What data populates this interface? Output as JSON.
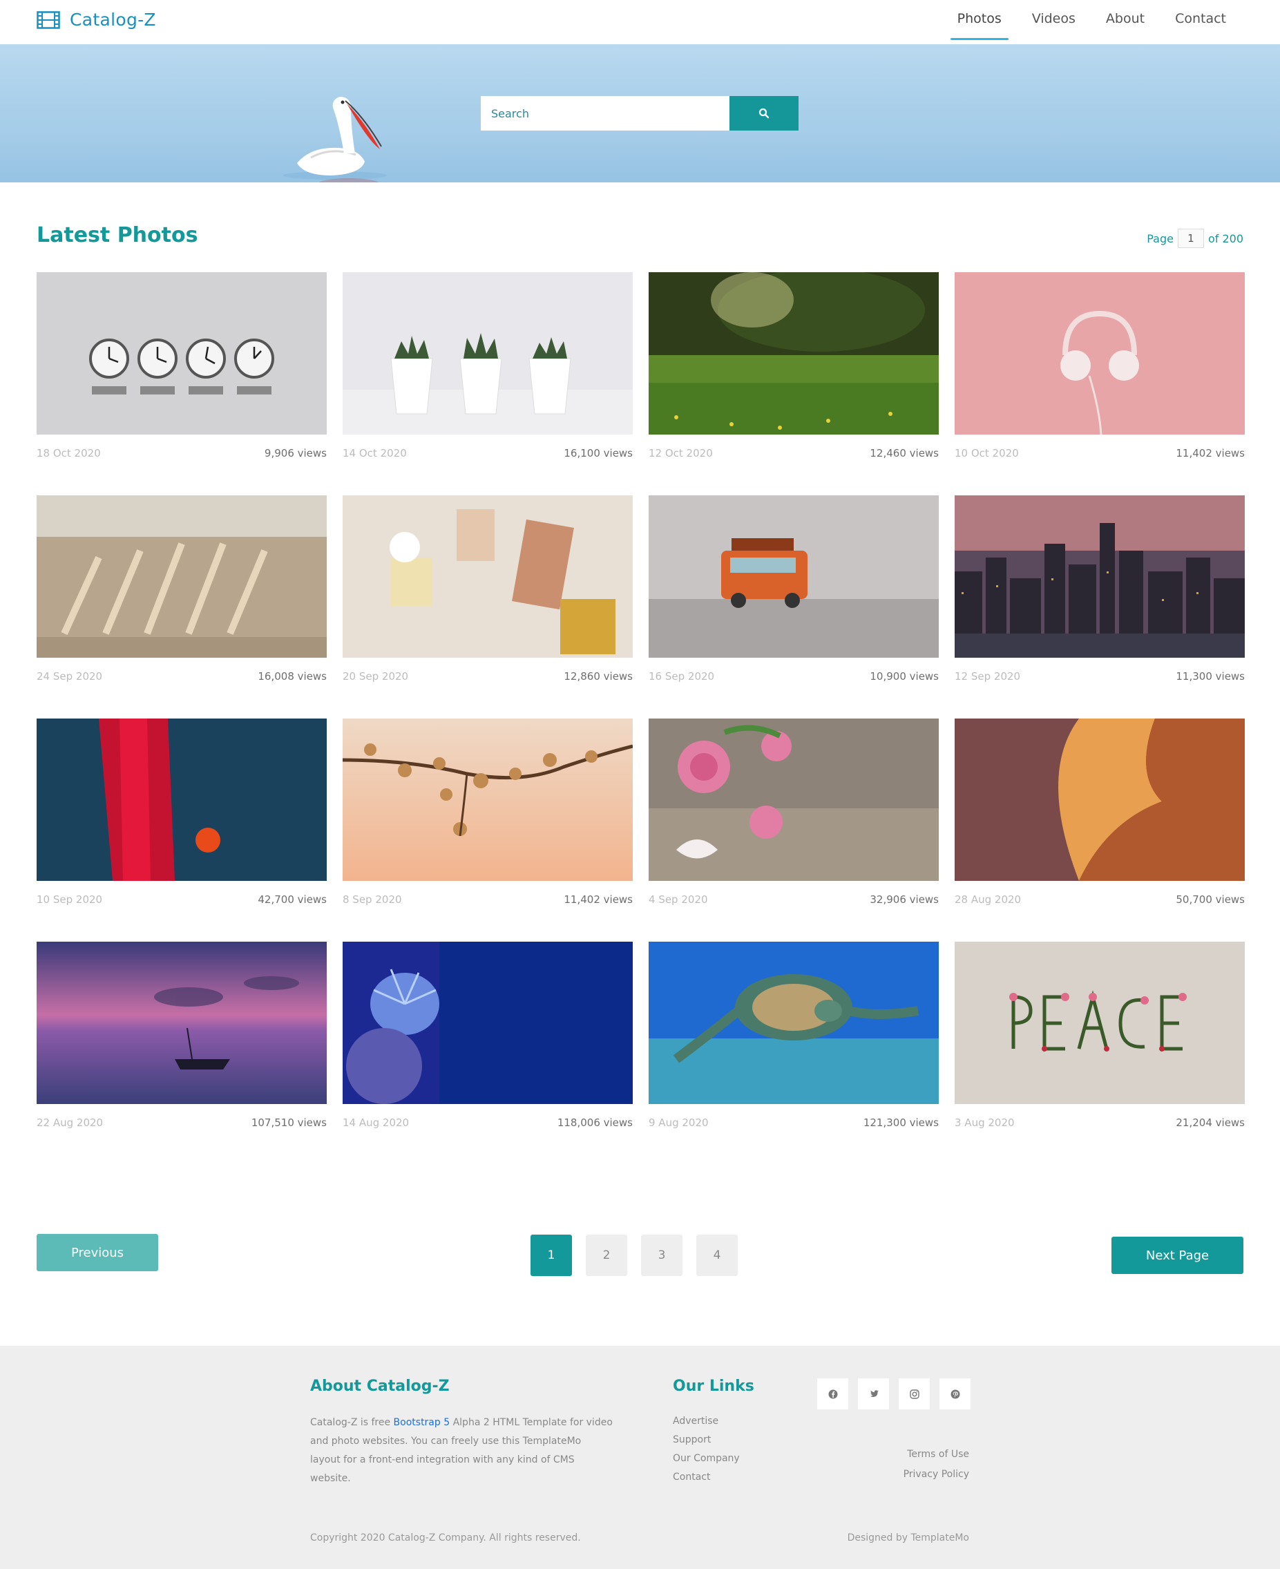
{
  "brand": {
    "name": "Catalog-Z",
    "icon": "film-icon",
    "color": "#1a8fc1"
  },
  "nav": [
    {
      "label": "Photos",
      "active": true
    },
    {
      "label": "Videos",
      "active": false
    },
    {
      "label": "About",
      "active": false
    },
    {
      "label": "Contact",
      "active": false
    }
  ],
  "search": {
    "placeholder": "Search",
    "button_icon": "search-icon"
  },
  "section": {
    "title": "Latest Photos"
  },
  "pager_top": {
    "prefix": "Page",
    "current": "1",
    "suffix": "of 200"
  },
  "photos": [
    {
      "date": "18 Oct 2020",
      "views": "9,906 views",
      "subject": "world-clocks"
    },
    {
      "date": "14 Oct 2020",
      "views": "16,100 views",
      "subject": "succulent-pots"
    },
    {
      "date": "12 Oct 2020",
      "views": "12,460 views",
      "subject": "sunlit-meadow"
    },
    {
      "date": "10 Oct 2020",
      "views": "11,402 views",
      "subject": "headphones-on-pink"
    },
    {
      "date": "24 Sep 2020",
      "views": "16,008 views",
      "subject": "wooden-hangers"
    },
    {
      "date": "20 Sep 2020",
      "views": "12,860 views",
      "subject": "perfume-bottles"
    },
    {
      "date": "16 Sep 2020",
      "views": "10,900 views",
      "subject": "toy-bus"
    },
    {
      "date": "12 Sep 2020",
      "views": "11,300 views",
      "subject": "city-skyline"
    },
    {
      "date": "10 Sep 2020",
      "views": "42,700 views",
      "subject": "abstract-paint"
    },
    {
      "date": "8 Sep 2020",
      "views": "11,402 views",
      "subject": "blossom-branch"
    },
    {
      "date": "4 Sep 2020",
      "views": "32,906 views",
      "subject": "pink-roses"
    },
    {
      "date": "28 Aug 2020",
      "views": "50,700 views",
      "subject": "canyon-rocks"
    },
    {
      "date": "22 Aug 2020",
      "views": "107,510 views",
      "subject": "sunset-boat"
    },
    {
      "date": "14 Aug 2020",
      "views": "118,006 views",
      "subject": "sea-anemone"
    },
    {
      "date": "9 Aug 2020",
      "views": "121,300 views",
      "subject": "sea-turtle"
    },
    {
      "date": "3 Aug 2020",
      "views": "21,204 views",
      "subject": "peace-flowers"
    }
  ],
  "pagination": {
    "previous": "Previous",
    "pages": [
      "1",
      "2",
      "3",
      "4"
    ],
    "active_page": "1",
    "next": "Next Page"
  },
  "footer": {
    "about_title": "About Catalog-Z",
    "about_text_before": "Catalog-Z is free ",
    "about_link": "Bootstrap 5",
    "about_text_after": " Alpha 2 HTML Template for video and photo websites. You can freely use this TemplateMo layout for a front-end integration with any kind of CMS website.",
    "links_title": "Our Links",
    "links": [
      "Advertise",
      "Support",
      "Our Company",
      "Contact"
    ],
    "social_icons": [
      "facebook-icon",
      "twitter-icon",
      "instagram-icon",
      "pinterest-icon"
    ],
    "right_links": [
      "Terms of Use",
      "Privacy Policy"
    ],
    "copyright": "Copyright 2020 Catalog-Z Company. All rights reserved.",
    "designed_by": "Designed by TemplateMo"
  },
  "colors": {
    "accent": "#14999a",
    "prev_button": "#5dbbb7",
    "nav_underline": "#2fb5e3",
    "footer_bg": "#eeeeee"
  }
}
